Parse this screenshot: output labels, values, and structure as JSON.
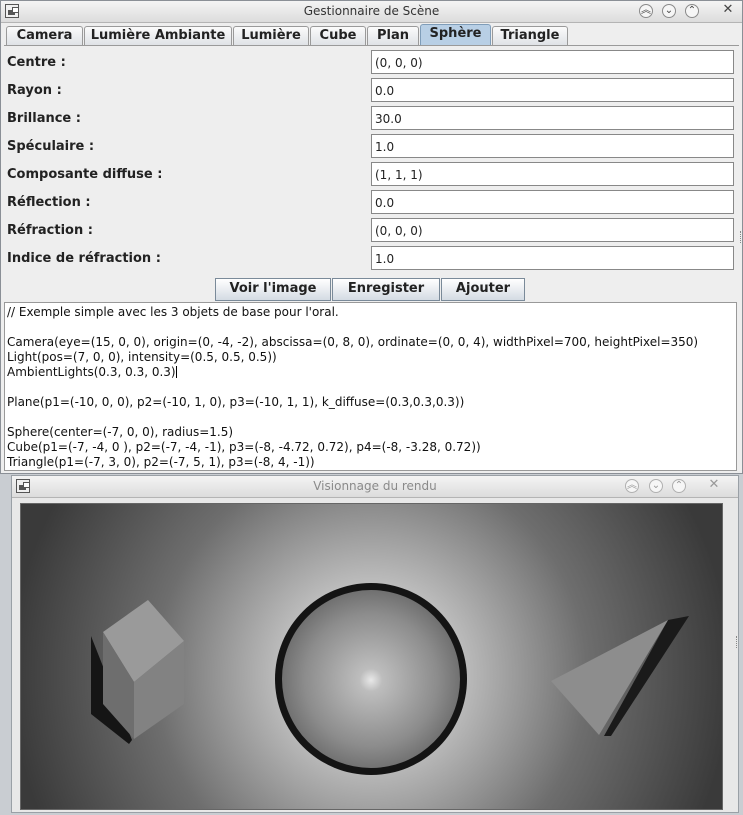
{
  "scene_manager": {
    "title": "Gestionnaire de Scène",
    "tabs": [
      {
        "label": "Camera"
      },
      {
        "label": "Lumière Ambiante"
      },
      {
        "label": "Lumière"
      },
      {
        "label": "Cube"
      },
      {
        "label": "Plan"
      },
      {
        "label": "Sphère"
      },
      {
        "label": "Triangle"
      }
    ],
    "active_tab": "Sphère",
    "fields": [
      {
        "label": "Centre :",
        "value": "(0, 0, 0)"
      },
      {
        "label": "Rayon :",
        "value": "0.0"
      },
      {
        "label": "Brillance :",
        "value": "30.0"
      },
      {
        "label": "Spéculaire :",
        "value": "1.0"
      },
      {
        "label": "Composante diffuse :",
        "value": "(1, 1, 1)"
      },
      {
        "label": "Réflection :",
        "value": "0.0"
      },
      {
        "label": "Réfraction :",
        "value": "(0, 0, 0)"
      },
      {
        "label": "Indice de réfraction :",
        "value": "1.0"
      }
    ],
    "buttons": {
      "view": "Voir l'image",
      "save": "Enregister",
      "add": "Ajouter"
    },
    "script_lines": [
      "// Exemple simple avec les 3 objets de base pour l'oral.",
      "",
      "Camera(eye=(15, 0, 0), origin=(0, -4, -2), abscissa=(0, 8, 0), ordinate=(0, 0, 4), widthPixel=700, heightPixel=350)",
      "Light(pos=(7, 0, 0), intensity=(0.5, 0.5, 0.5))",
      "AmbientLights(0.3, 0.3, 0.3)",
      "",
      "Plane(p1=(-10, 0, 0), p2=(-10, 1, 0), p3=(-10, 1, 1), k_diffuse=(0.3,0.3,0.3))",
      "",
      "Sphere(center=(-7, 0, 0), radius=1.5)",
      "Cube(p1=(-7, -4, 0 ), p2=(-7, -4, -1), p3=(-8, -4.72, 0.72), p4=(-8, -3.28, 0.72))",
      "Triangle(p1=(-7, 3, 0), p2=(-7, 5, 1), p3=(-8, 4, -1))"
    ]
  },
  "render_viewer": {
    "title": "Visionnage du rendu"
  },
  "colors": {
    "active_tab": "#b8cfe5",
    "window_bg": "#eeeeee",
    "render_bg": "#3a3a3a"
  }
}
